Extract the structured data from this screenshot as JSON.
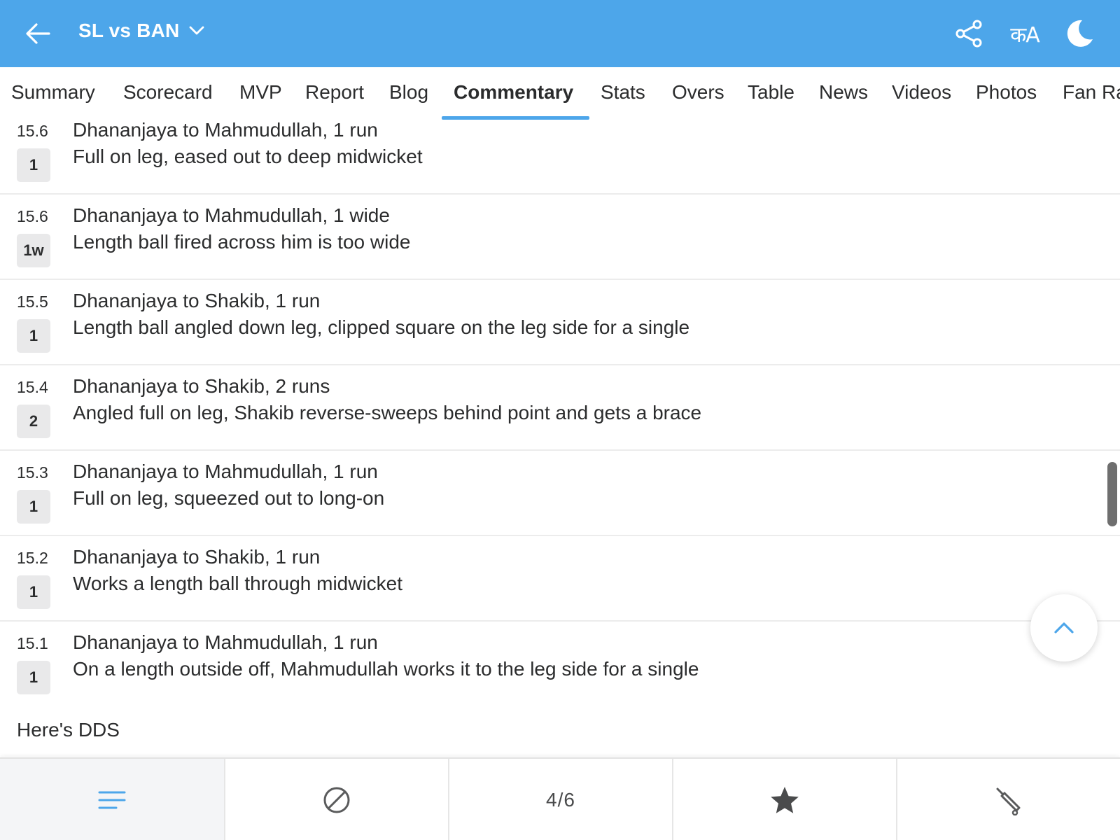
{
  "header": {
    "title": "SL vs BAN",
    "icons": [
      "back-arrow-icon",
      "chevron-down-icon",
      "share-icon",
      "language-icon",
      "dark-mode-icon"
    ],
    "lang_glyph": "कA",
    "bg_color": "#4da6ea"
  },
  "tabs": [
    {
      "label": "Summary"
    },
    {
      "label": "Scorecard"
    },
    {
      "label": "MVP"
    },
    {
      "label": "Report"
    },
    {
      "label": "Blog"
    },
    {
      "label": "Commentary",
      "active": true
    },
    {
      "label": "Stats"
    },
    {
      "label": "Overs"
    },
    {
      "label": "Table"
    },
    {
      "label": "News"
    },
    {
      "label": "Videos"
    },
    {
      "label": "Photos"
    },
    {
      "label": "Fan Ra"
    }
  ],
  "commentary": [
    {
      "over": "15.6",
      "badge": "1",
      "headline": "Dhananjaya to Mahmudullah, 1 run",
      "text": "Full on leg, eased out to deep midwicket"
    },
    {
      "over": "15.6",
      "badge": "1w",
      "headline": "Dhananjaya to Mahmudullah, 1 wide",
      "text": "Length ball fired across him is too wide"
    },
    {
      "over": "15.5",
      "badge": "1",
      "headline": "Dhananjaya to Shakib, 1 run",
      "text": "Length ball angled down leg, clipped square on the leg side for a single"
    },
    {
      "over": "15.4",
      "badge": "2",
      "headline": "Dhananjaya to Shakib, 2 runs",
      "text": "Angled full on leg, Shakib reverse-sweeps behind point and gets a brace"
    },
    {
      "over": "15.3",
      "badge": "1",
      "headline": "Dhananjaya to Mahmudullah, 1 run",
      "text": "Full on leg, squeezed out to long-on"
    },
    {
      "over": "15.2",
      "badge": "1",
      "headline": "Dhananjaya to Shakib, 1 run",
      "text": "Works a length ball through midwicket"
    },
    {
      "over": "15.1",
      "badge": "1",
      "headline": "Dhananjaya to Mahmudullah, 1 run",
      "text": "On a length outside off, Mahmudullah works it to the leg side for a single"
    }
  ],
  "note": "Here's DDS",
  "bottom_bar": {
    "items": [
      {
        "icon": "menu-icon"
      },
      {
        "icon": "ball-icon"
      },
      {
        "label": "4/6"
      },
      {
        "icon": "star-icon"
      },
      {
        "icon": "cricket-bat-icon"
      }
    ]
  },
  "fab": {
    "icon": "chevron-up-icon"
  },
  "colors": {
    "accent": "#4da6ea",
    "badge_bg": "#e9e9ea",
    "text": "#2b2c2d"
  }
}
